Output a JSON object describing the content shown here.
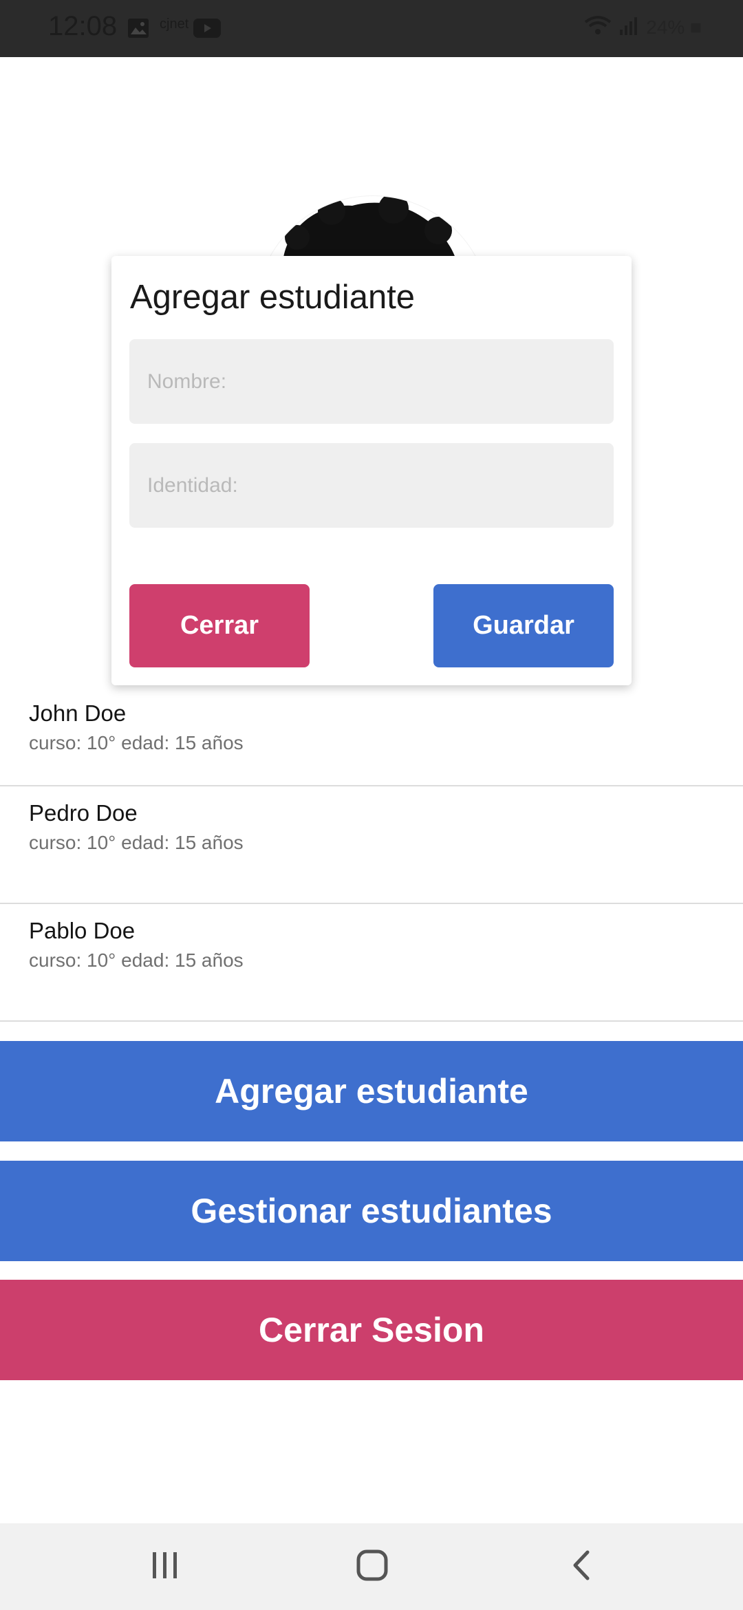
{
  "status_bar": {
    "time": "12:08",
    "icons": [
      "image-icon",
      "cjnet-icon",
      "youtube-icon",
      "wifi-icon",
      "signal-icon"
    ],
    "cjnet_label": "cjnet",
    "right_text": "24% ■"
  },
  "modal": {
    "title": "Agregar estudiante",
    "name_placeholder": "Nombre:",
    "id_placeholder": "Identidad:",
    "close_label": "Cerrar",
    "save_label": "Guardar",
    "close_color": "#cf3f6d",
    "save_color": "#3e6fce"
  },
  "students": [
    {
      "name": "John Doe",
      "meta": "curso: 10° edad: 15 años"
    },
    {
      "name": "Pedro Doe",
      "meta": "curso: 10° edad: 15 años"
    },
    {
      "name": "Pablo Doe",
      "meta": "curso: 10° edad: 15 años"
    }
  ],
  "actions": {
    "add_label": "Agregar estudiante",
    "manage_label": "Gestionar estudiantes",
    "logout_label": "Cerrar Sesion"
  },
  "nav_bar": {
    "icons": [
      "recent-apps-icon",
      "home-icon",
      "back-icon"
    ]
  }
}
